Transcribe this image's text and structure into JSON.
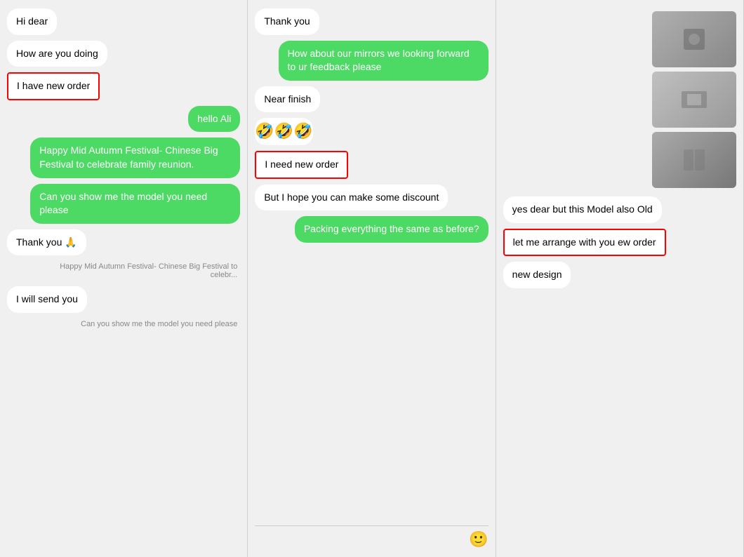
{
  "col1": {
    "messages": [
      {
        "id": "hi-dear",
        "text": "Hi dear",
        "type": "left-white"
      },
      {
        "id": "how-are-you",
        "text": "How are you doing",
        "type": "left-white"
      },
      {
        "id": "i-have-new-order",
        "text": "I have new order",
        "type": "left-outlined"
      },
      {
        "id": "hello-ali",
        "text": "hello Ali",
        "type": "right-green"
      },
      {
        "id": "happy-mid",
        "text": "Happy Mid Autumn Festival- Chinese Big Festival to celebrate family reunion.",
        "type": "right-green"
      },
      {
        "id": "can-you-show",
        "text": "Can you show me the model you need please",
        "type": "right-green"
      },
      {
        "id": "thank-you-pray",
        "text": "Thank you 🙏",
        "type": "left-white"
      },
      {
        "id": "happy-mid-preview",
        "text": "Happy Mid Autumn Festival- Chinese Big Festival to celebr...",
        "type": "right-gray-small"
      },
      {
        "id": "i-will-send",
        "text": "I will send you",
        "type": "left-white"
      },
      {
        "id": "can-you-show-preview",
        "text": "Can you show me the model you need please",
        "type": "right-gray-small"
      }
    ]
  },
  "col2": {
    "messages": [
      {
        "id": "thank-you",
        "text": "Thank you",
        "type": "left-white"
      },
      {
        "id": "how-about-mirrors",
        "text": "How about our mirrors we looking forward to ur feedback please",
        "type": "right-green"
      },
      {
        "id": "near-finish",
        "text": "Near finish",
        "type": "left-white"
      },
      {
        "id": "emojis",
        "text": "🤣🤣🤣",
        "type": "left-emoji"
      },
      {
        "id": "i-need-new-order",
        "text": "I need new order",
        "type": "left-outlined"
      },
      {
        "id": "but-hope",
        "text": "But I hope you can make some discount",
        "type": "left-white"
      },
      {
        "id": "packing-everything",
        "text": "Packing everything the same as before?",
        "type": "right-green"
      }
    ],
    "bottomIcon": "🙂"
  },
  "col3": {
    "messages": [
      {
        "id": "yes-dear",
        "text": "yes dear but this Model also Old",
        "type": "left-white"
      },
      {
        "id": "let-me-arrange",
        "text": "let me arrange with you ew order",
        "type": "left-outlined-right"
      },
      {
        "id": "new-design",
        "text": "new design",
        "type": "left-white"
      }
    ],
    "photos": [
      {
        "id": "photo-1",
        "label": "mirror photo 1"
      },
      {
        "id": "photo-2",
        "label": "mirror photo 2"
      },
      {
        "id": "photo-3",
        "label": "mirror photo 3"
      }
    ]
  }
}
